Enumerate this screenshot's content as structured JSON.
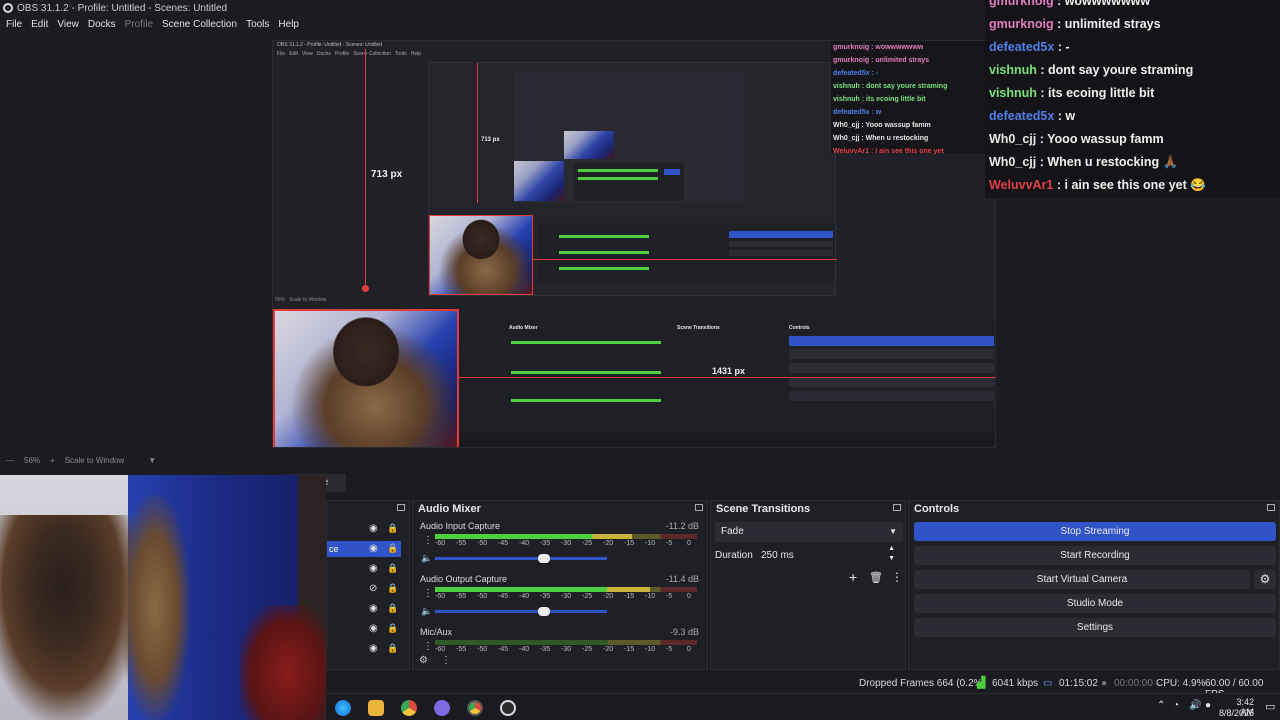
{
  "window": {
    "title": "OBS 31.1.2 - Profile: Untitled - Scenes: Untitled",
    "min": "—",
    "max": "▢",
    "close": "✕"
  },
  "menu": {
    "file": "File",
    "edit": "Edit",
    "view": "View",
    "docks": "Docks",
    "profile": "Profile",
    "scene_collection": "Scene Collection",
    "tools": "Tools",
    "help": "Help"
  },
  "preview": {
    "height_label": "713 px",
    "width_label": "1431 px",
    "nested_title": "OBS 31.1.2 - Profile: Untitled - Scenes: Untitled",
    "nested_height_label": "713 px"
  },
  "chat": [
    {
      "user": "gmurknoig",
      "msg": "wowwwwwww",
      "color": "#e07cc0"
    },
    {
      "user": "gmurknoig",
      "msg": "unlimited strays",
      "color": "#e07cc0"
    },
    {
      "user": "defeated5x",
      "msg": "-",
      "color": "#4f7fe8"
    },
    {
      "user": "vishnuh",
      "msg": "dont say youre straming",
      "color": "#7be07b"
    },
    {
      "user": "vishnuh",
      "msg": "its ecoing little bit",
      "color": "#7be07b"
    },
    {
      "user": "defeated5x",
      "msg": "w",
      "color": "#4f7fe8"
    },
    {
      "user": "Wh0_cjj",
      "msg": "Yooo wassup famm",
      "color": "#e8e8e8"
    },
    {
      "user": "Wh0_cjj",
      "msg": "When u restocking 🙏🏾",
      "color": "#e8e8e8"
    },
    {
      "user": "WeluvvAr1",
      "msg": "i ain see this one yet 😂",
      "color": "#e0404a"
    }
  ],
  "zoom": {
    "percent": "56%",
    "mode": "Scale to Window"
  },
  "audio_mixer": {
    "title": "Audio Mixer",
    "scale": [
      "-60",
      "-55",
      "-50",
      "-45",
      "-40",
      "-35",
      "-30",
      "-25",
      "-20",
      "-15",
      "-10",
      "-5",
      "0"
    ],
    "channels": [
      {
        "name": "Audio Input Capture",
        "db": "-11.2 dB",
        "level": 0.75,
        "volume": 0.6
      },
      {
        "name": "Audio Output Capture",
        "db": "-11.4 dB",
        "level": 0.82,
        "volume": 0.6
      },
      {
        "name": "Mic/Aux",
        "db": "-9.3 dB",
        "level": 0.0,
        "volume": 0.6
      }
    ]
  },
  "scene_transitions": {
    "title": "Scene Transitions",
    "transition": "Fade",
    "duration_label": "Duration",
    "duration": "250 ms"
  },
  "controls": {
    "title": "Controls",
    "stop_streaming": "Stop Streaming",
    "start_recording": "Start Recording",
    "start_virtual_camera": "Start Virtual Camera",
    "studio_mode": "Studio Mode",
    "settings": "Settings"
  },
  "sources_tab_fragment": "te",
  "source_selected_fragment": "ce",
  "status": {
    "dropped_frames": "Dropped Frames 664 (0.2%)",
    "bitrate": "6041 kbps",
    "stream_time": "01:15:02",
    "record_time": "00:00:00",
    "cpu": "CPU: 4.9%",
    "fps": "60.00 / 60.00 FPS"
  },
  "taskbar": {
    "time": "3:42 AM",
    "date": "8/8/2025"
  },
  "colors": {
    "accent": "#3053c8",
    "meter_green": "#4ecf3f",
    "meter_yellow": "#c9b33a",
    "meter_red": "#c0392b",
    "guide_red": "#e03c3c"
  },
  "icons": [
    "eye-icon",
    "lock-icon",
    "gear-icon",
    "plus-icon",
    "trash-icon",
    "kebab-icon",
    "speaker-icon",
    "network-icon",
    "mic-icon",
    "edge-icon",
    "folder-icon",
    "chrome-icon",
    "obs-icon"
  ]
}
